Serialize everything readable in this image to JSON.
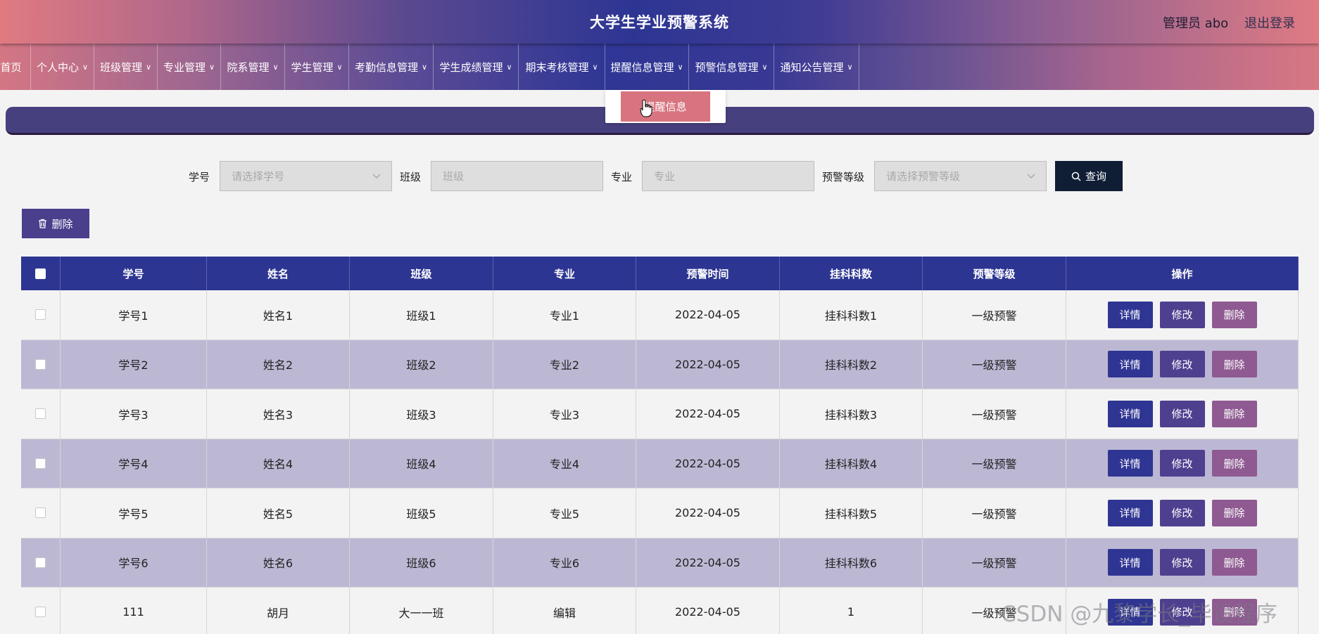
{
  "header": {
    "title": "大学生学业预警系统",
    "admin": "管理员 abo",
    "logout": "退出登录"
  },
  "nav": [
    {
      "label": "首页",
      "chevron": false
    },
    {
      "label": "个人中心",
      "chevron": true
    },
    {
      "label": "班级管理",
      "chevron": true
    },
    {
      "label": "专业管理",
      "chevron": true
    },
    {
      "label": "院系管理",
      "chevron": true
    },
    {
      "label": "学生管理",
      "chevron": true
    },
    {
      "label": "考勤信息管理",
      "chevron": true
    },
    {
      "label": "学生成绩管理",
      "chevron": true
    },
    {
      "label": "期末考核管理",
      "chevron": true
    },
    {
      "label": "提醒信息管理",
      "chevron": true
    },
    {
      "label": "预警信息管理",
      "chevron": true
    },
    {
      "label": "通知公告管理",
      "chevron": true
    }
  ],
  "dropdown": {
    "item": "提醒信息"
  },
  "search": {
    "student_id_label": "学号",
    "student_id_placeholder": "请选择学号",
    "class_label": "班级",
    "class_placeholder": "班级",
    "major_label": "专业",
    "major_placeholder": "专业",
    "level_label": "预警等级",
    "level_placeholder": "请选择预警等级",
    "query_label": "查询"
  },
  "batch_delete_label": "删除",
  "table": {
    "columns": [
      "学号",
      "姓名",
      "班级",
      "专业",
      "预警时间",
      "挂科科数",
      "预警等级",
      "操作"
    ],
    "rows": [
      [
        "学号1",
        "姓名1",
        "班级1",
        "专业1",
        "2022-04-05",
        "挂科科数1",
        "一级预警"
      ],
      [
        "学号2",
        "姓名2",
        "班级2",
        "专业2",
        "2022-04-05",
        "挂科科数2",
        "一级预警"
      ],
      [
        "学号3",
        "姓名3",
        "班级3",
        "专业3",
        "2022-04-05",
        "挂科科数3",
        "一级预警"
      ],
      [
        "学号4",
        "姓名4",
        "班级4",
        "专业4",
        "2022-04-05",
        "挂科科数4",
        "一级预警"
      ],
      [
        "学号5",
        "姓名5",
        "班级5",
        "专业5",
        "2022-04-05",
        "挂科科数5",
        "一级预警"
      ],
      [
        "学号6",
        "姓名6",
        "班级6",
        "专业6",
        "2022-04-05",
        "挂科科数6",
        "一级预警"
      ],
      [
        "111",
        "胡月",
        "大一一班",
        "编辑",
        "2022-04-05",
        "1",
        "一级预警"
      ]
    ],
    "actions": [
      "详情",
      "修改",
      "删除"
    ]
  },
  "watermark": "CSDN @九黎学长_毕设程序",
  "colors": {
    "header_accent": "#2d3592",
    "dropdown_active": "#d8747f",
    "query_button": "#0f1e35",
    "row_alt": "#bcb8d4"
  }
}
